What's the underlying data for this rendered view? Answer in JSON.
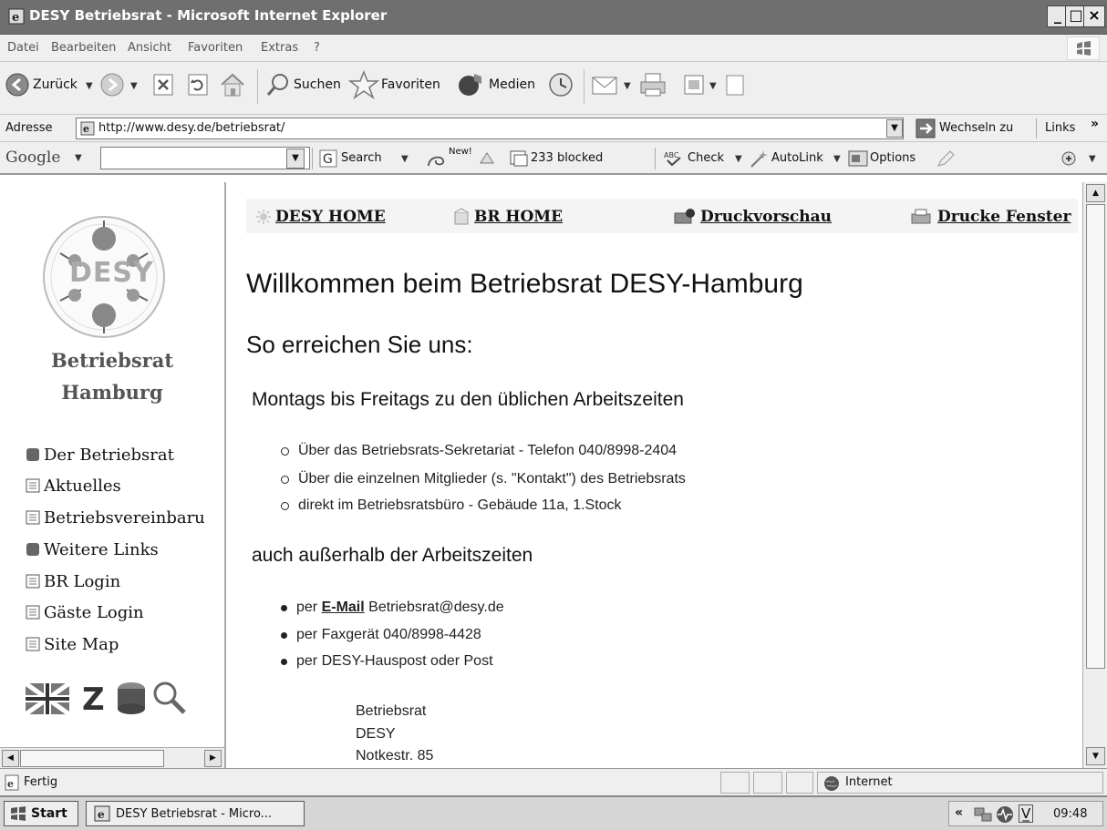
{
  "window": {
    "title": "DESY Betriebsrat - Microsoft Internet Explorer",
    "minimize": "_",
    "maximize": "□",
    "close": "×"
  },
  "menu": [
    "Datei",
    "Bearbeiten",
    "Ansicht",
    "Favoriten",
    "Extras",
    "?"
  ],
  "toolbar": {
    "back": "Zurück",
    "search": "Suchen",
    "favorites": "Favoriten",
    "media": "Medien"
  },
  "address": {
    "label": "Adresse",
    "url": "http://www.desy.de/betriebsrat/",
    "go": "Wechseln zu",
    "links": "Links"
  },
  "google_bar": {
    "logo": "Google",
    "search": "Search",
    "new_badge": "New!",
    "blocked": "233 blocked",
    "check": "Check",
    "autolink": "AutoLink",
    "options": "Options"
  },
  "sidebar": {
    "logo_text": "DESY",
    "title_line1": "Betriebsrat",
    "title_line2": "Hamburg",
    "items": [
      {
        "label": "Der Betriebsrat",
        "icon": "folder-icon"
      },
      {
        "label": "Aktuelles",
        "icon": "page-icon"
      },
      {
        "label": "Betriebsvereinbaru",
        "icon": "page-icon"
      },
      {
        "label": "Weitere Links",
        "icon": "folder-icon"
      },
      {
        "label": "BR Login",
        "icon": "page-icon"
      },
      {
        "label": "Gäste Login",
        "icon": "page-icon"
      },
      {
        "label": "Site Map",
        "icon": "page-icon"
      }
    ],
    "bottom_icons": [
      "flag-icon",
      "z-icon",
      "box-icon",
      "magnifier-icon"
    ],
    "z_glyph": "Z"
  },
  "content": {
    "topnav": [
      "DESY HOME",
      "BR HOME",
      "Druckvorschau",
      "Drucke Fenster"
    ],
    "heading1": "Willkommen beim Betriebsrat DESY-Hamburg",
    "heading2": "So erreichen Sie uns:",
    "section1_title": "Montags bis Freitags zu den üblichen Arbeitszeiten",
    "section1_items": [
      "Über das Betriebsrats-Sekretariat - Telefon 040/8998-2404",
      "Über die einzelnen Mitglieder (s. \"Kontakt\") des Betriebsrats",
      "direkt im Betriebsratsbüro - Gebäude 11a, 1.Stock"
    ],
    "section2_title": "auch außerhalb der Arbeitszeiten",
    "section2_item1_prefix": "per ",
    "section2_item1_link": "E-Mail",
    "section2_item1_suffix": " Betriebsrat@desy.de",
    "section2_items": [
      "per Faxgerät 040/8998-4428",
      "per DESY-Hauspost oder Post"
    ],
    "postal_address": [
      "Betriebsrat",
      "DESY",
      "Notkestr. 85"
    ]
  },
  "status": {
    "text": "Fertig",
    "zone": "Internet"
  },
  "taskbar": {
    "start": "Start",
    "task": "DESY Betriebsrat - Micro...",
    "tray_arrows": "«",
    "tray_v": "V̲",
    "clock": "09:48"
  }
}
